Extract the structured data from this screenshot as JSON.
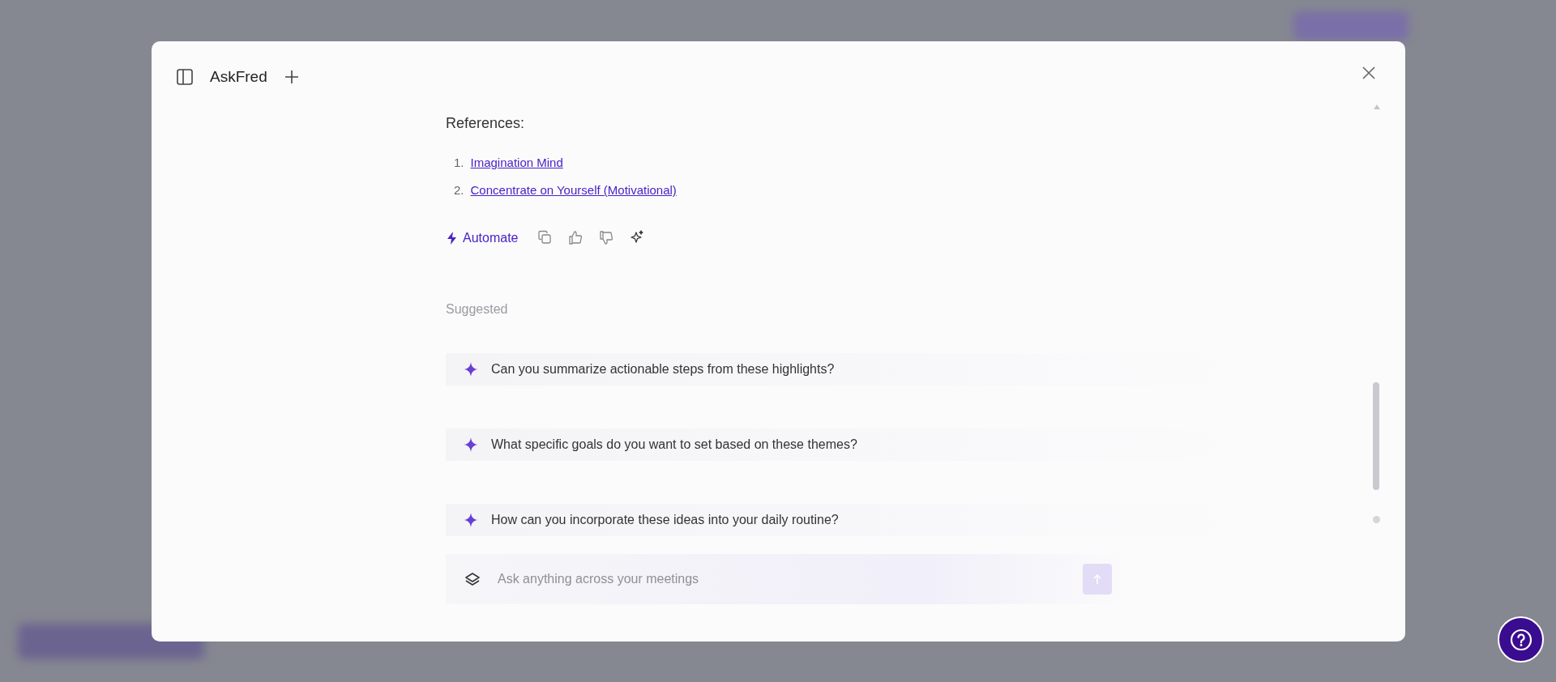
{
  "dialog": {
    "title": "AskFred",
    "references": {
      "heading": "References:",
      "items": [
        {
          "number": "1.",
          "title": "Imagination Mind"
        },
        {
          "number": "2.",
          "title": "Concentrate on Yourself (Motivational)"
        }
      ]
    },
    "actions": {
      "automate": "Automate"
    },
    "suggested": {
      "heading": "Suggested",
      "items": [
        "Can you summarize actionable steps from these highlights?",
        "What specific goals do you want to set based on these themes?",
        "How can you incorporate these ideas into your daily routine?"
      ]
    },
    "composer": {
      "placeholder": "Ask anything across your meetings"
    }
  }
}
